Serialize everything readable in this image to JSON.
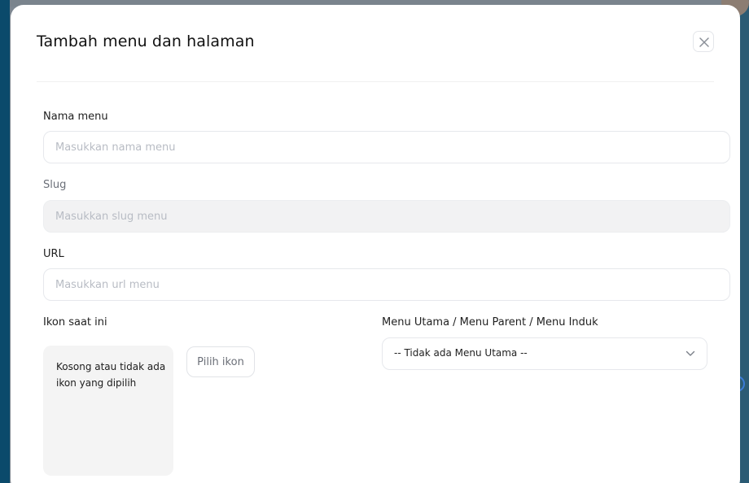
{
  "modal": {
    "title": "Tambah menu dan halaman"
  },
  "fields": {
    "name": {
      "label": "Nama menu",
      "placeholder": "Masukkan nama menu"
    },
    "slug": {
      "label": "Slug",
      "placeholder": "Masukkan slug menu"
    },
    "url": {
      "label": "URL",
      "placeholder": "Masukkan url menu"
    }
  },
  "icon": {
    "label": "Ikon saat ini",
    "empty_text": "Kosong atau tidak ada ikon yang dipilih",
    "pick_label": "Pilih ikon"
  },
  "parent_menu": {
    "label": "Menu Utama / Menu Parent / Menu Induk",
    "selected": "-- Tidak ada Menu Utama --"
  },
  "icons": {
    "close": "close-icon",
    "chevron": "chevron-down-icon"
  },
  "colors": {
    "backdrop": "#7d8791",
    "sidebar": "#0b4a6b",
    "modal_bg": "#ffffff",
    "disabled_input": "#f2f2f3",
    "icon_preview_bg": "#f4f4f4"
  }
}
